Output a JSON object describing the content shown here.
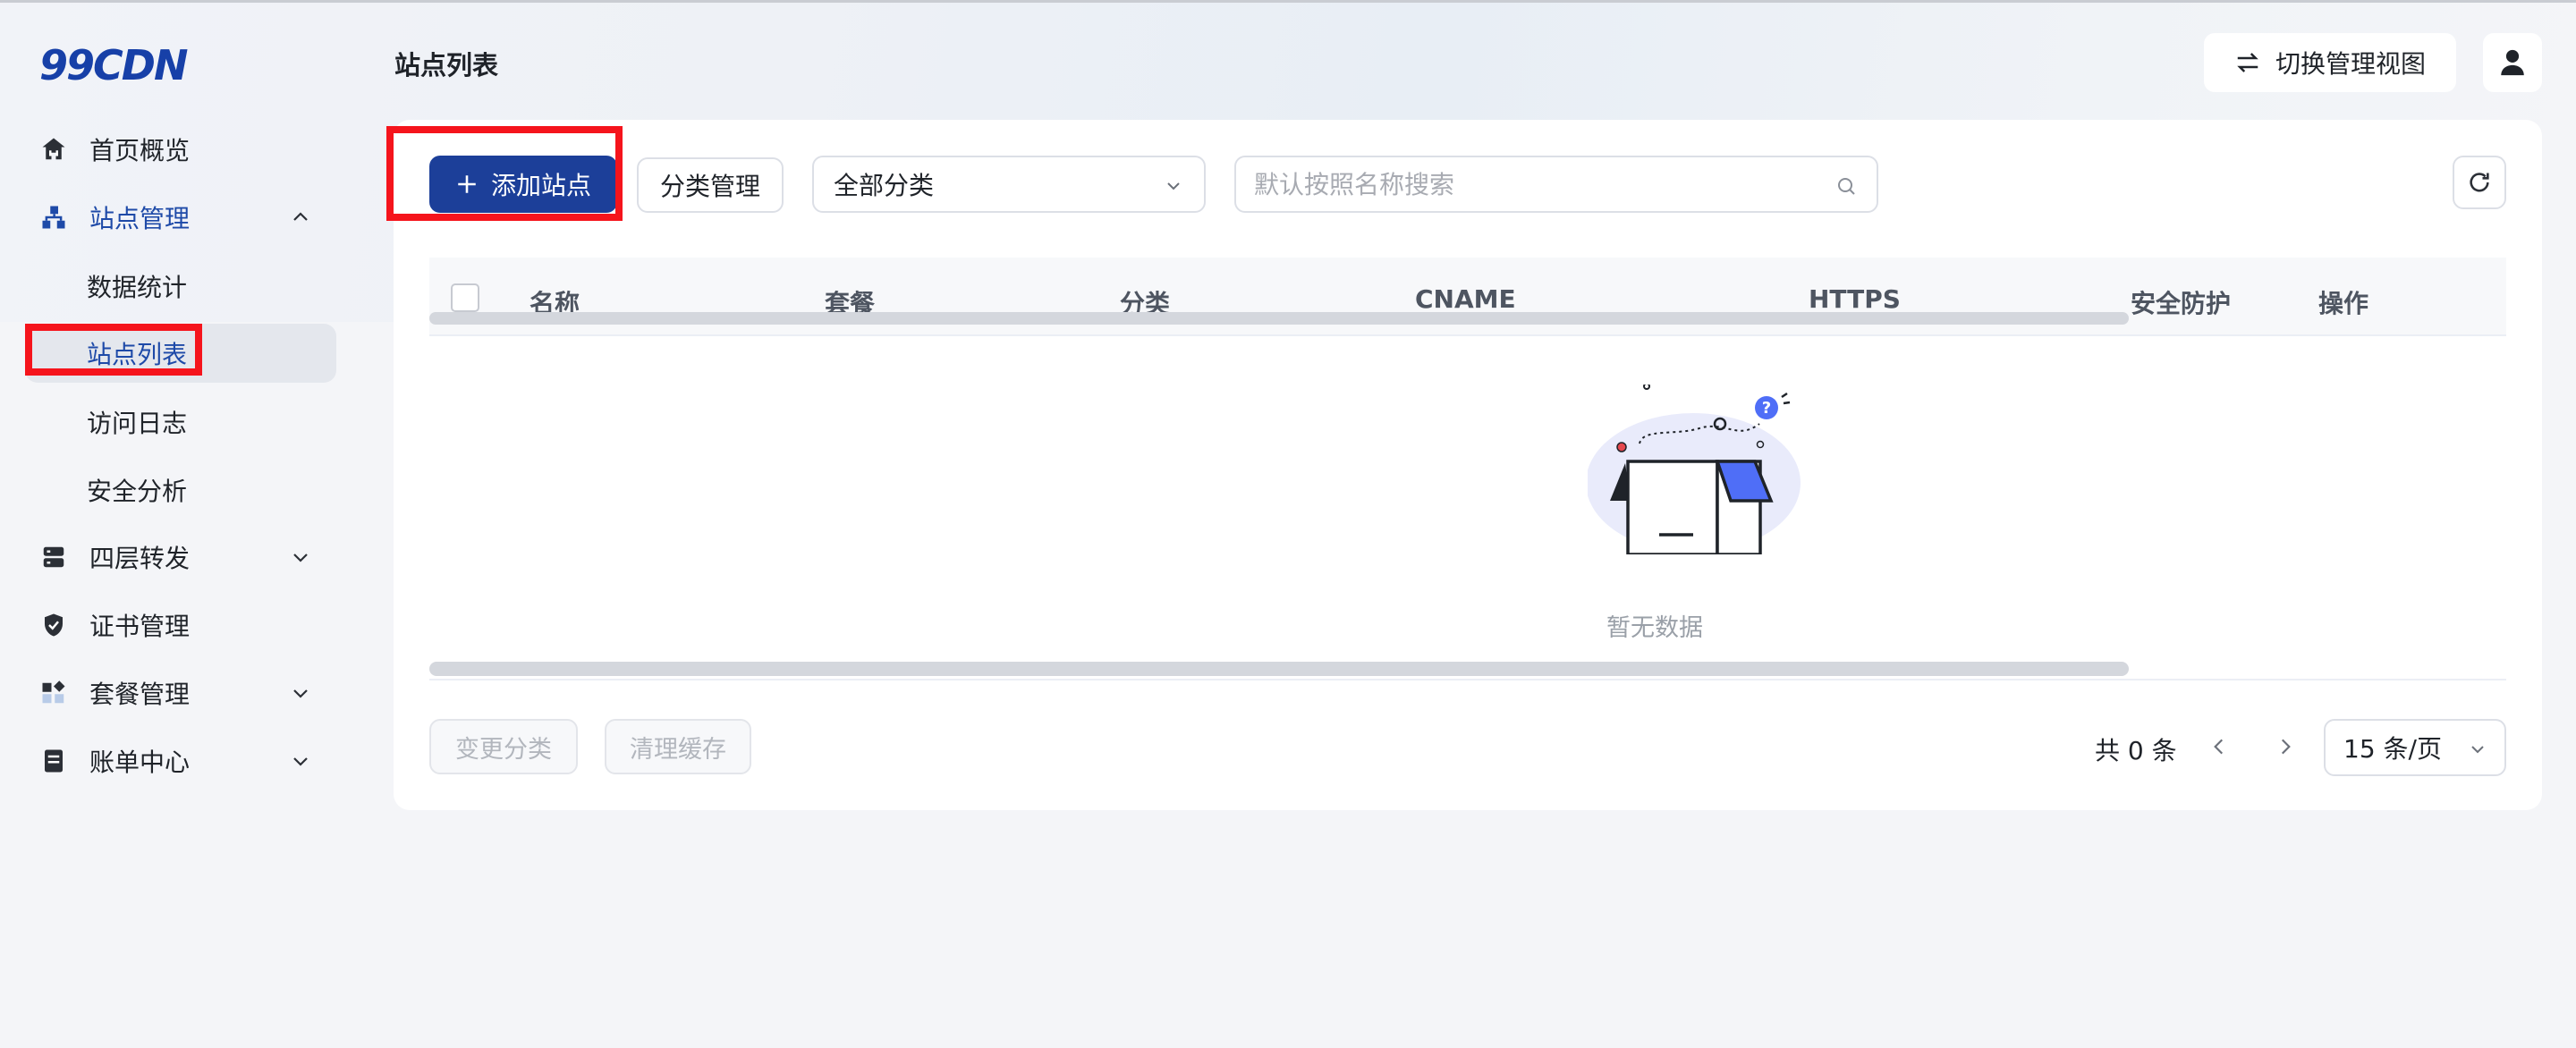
{
  "brand": {
    "logo_text": "99CDN",
    "accent": "#1c3f99",
    "active_text": "#1e4aa8",
    "highlight": "#f5141c"
  },
  "sidebar": {
    "items": [
      {
        "label": "首页概览",
        "icon": "home-icon"
      },
      {
        "label": "站点管理",
        "icon": "sitemap-icon",
        "expanded": true,
        "children": [
          {
            "label": "数据统计"
          },
          {
            "label": "站点列表",
            "selected": true
          },
          {
            "label": "访问日志"
          },
          {
            "label": "安全分析"
          }
        ]
      },
      {
        "label": "四层转发",
        "icon": "server-icon"
      },
      {
        "label": "证书管理",
        "icon": "shield-icon"
      },
      {
        "label": "套餐管理",
        "icon": "package-icon"
      },
      {
        "label": "账单中心",
        "icon": "bill-icon"
      }
    ]
  },
  "header": {
    "title": "站点列表",
    "switch_view_label": "切换管理视图"
  },
  "toolbar": {
    "add_site_label": "添加站点",
    "category_mgmt_label": "分类管理",
    "category_select_value": "全部分类",
    "search_placeholder": "默认按照名称搜索"
  },
  "table": {
    "columns": [
      "名称",
      "套餐",
      "分类",
      "CNAME",
      "HTTPS",
      "安全防护",
      "操作"
    ],
    "rows": [],
    "empty_text": "暂无数据"
  },
  "footer": {
    "change_category_label": "变更分类",
    "clear_cache_label": "清理缓存",
    "total_text": "共 0 条",
    "page_size_label": "15 条/页"
  }
}
